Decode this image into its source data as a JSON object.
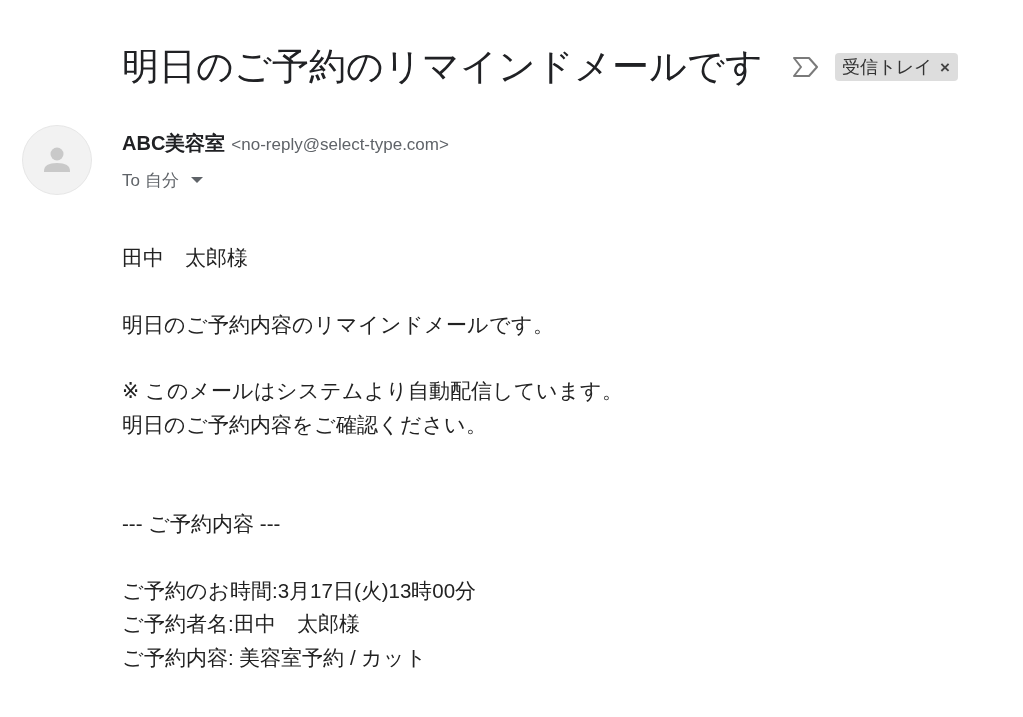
{
  "subject": "明日のご予約のリマインドメールです",
  "important": false,
  "labels": [
    {
      "name": "受信トレイ",
      "remove": "×"
    }
  ],
  "sender": {
    "name": "ABC美容室",
    "email": "<no-reply@select-type.com>"
  },
  "recipient": "To 自分",
  "body": {
    "paragraphs": [
      [
        "田中　太郎様"
      ],
      [
        "明日のご予約内容のリマインドメールです。"
      ],
      [
        "※ このメールはシステムより自動配信しています。",
        "明日のご予約内容をご確認ください。"
      ]
    ],
    "details": {
      "heading": "--- ご予約内容 ---",
      "lines": [
        "ご予約のお時間:3月17日(火)13時00分",
        "ご予約者名:田中　太郎様",
        "ご予約内容: 美容室予約 / カット"
      ]
    }
  }
}
